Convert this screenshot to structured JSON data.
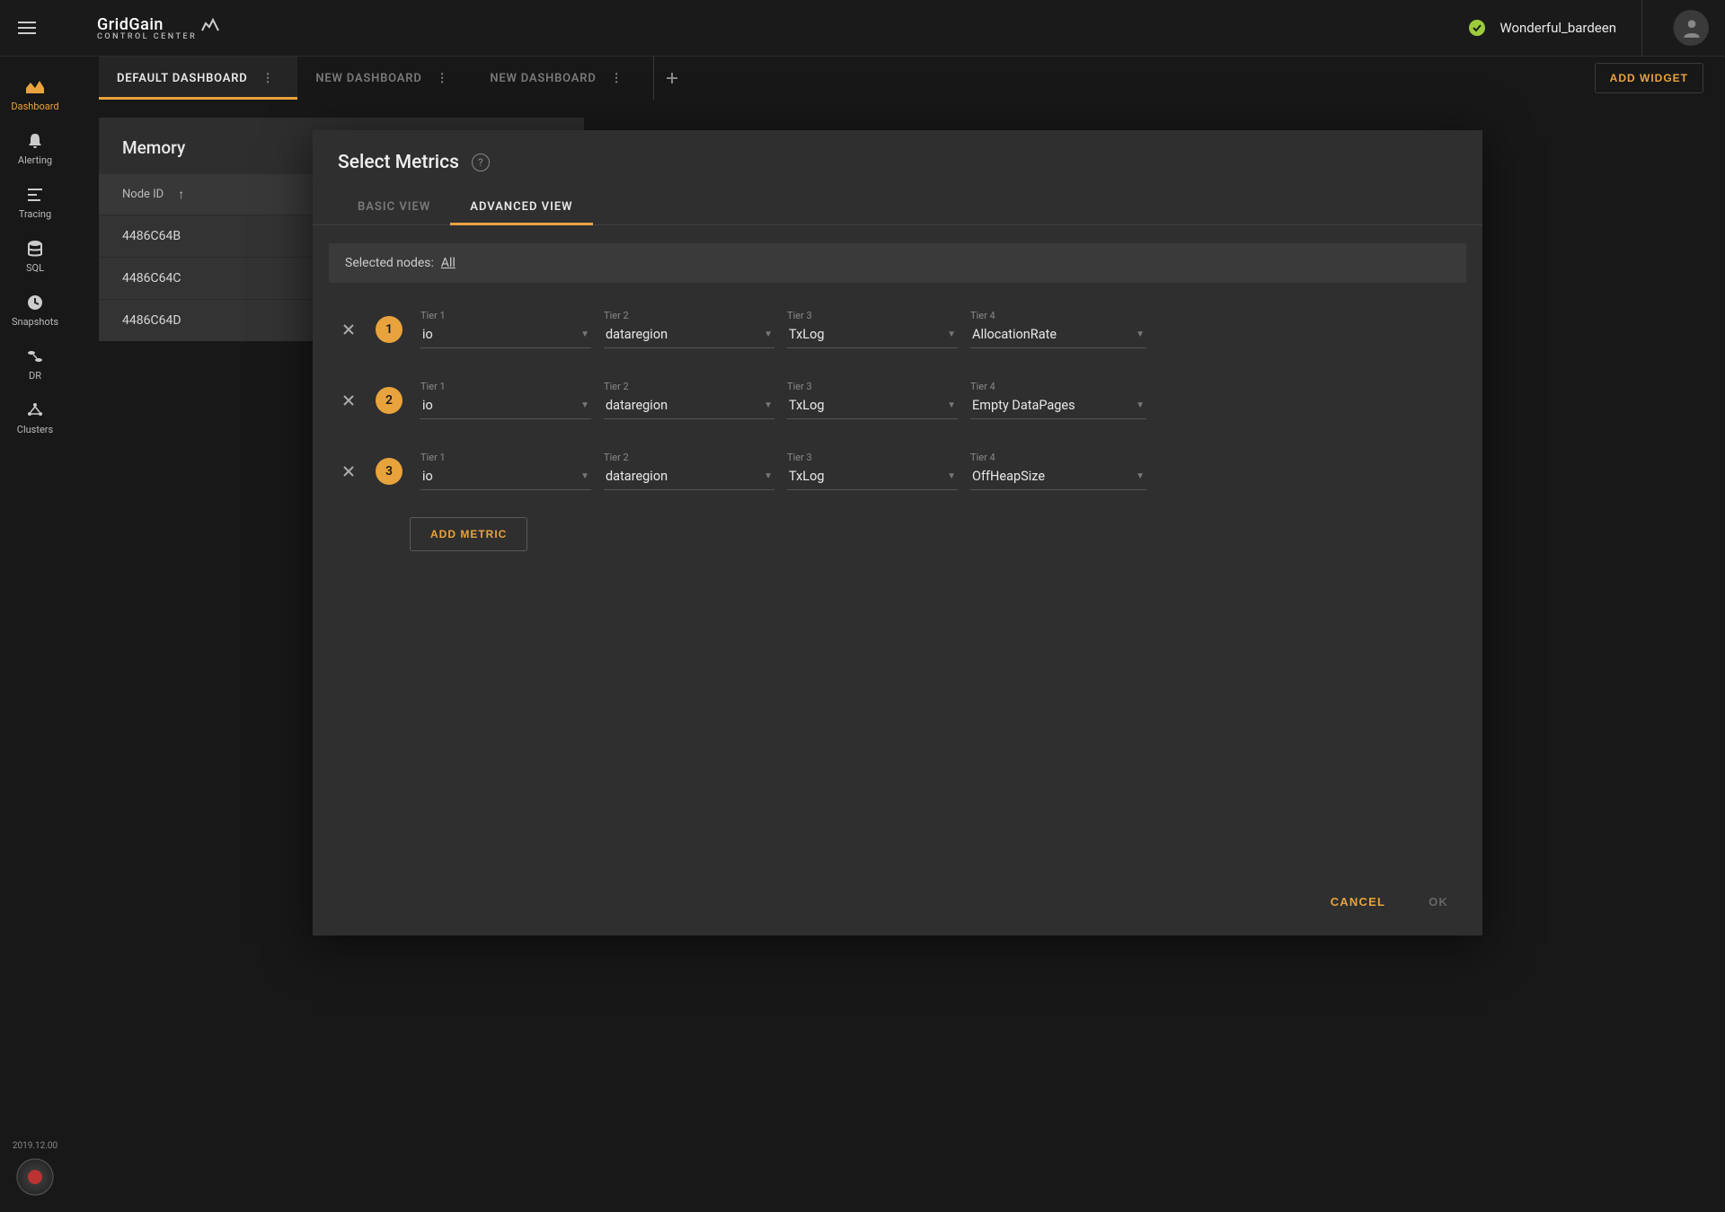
{
  "header": {
    "logo_main": "GridGain",
    "logo_sub": "CONTROL CENTER",
    "username": "Wonderful_bardeen"
  },
  "sidebar": {
    "items": [
      {
        "label": "Dashboard",
        "icon": "chart-area-icon",
        "active": true
      },
      {
        "label": "Alerting",
        "icon": "bell-icon",
        "active": false
      },
      {
        "label": "Tracing",
        "icon": "bars-icon",
        "active": false
      },
      {
        "label": "SQL",
        "icon": "database-icon",
        "active": false
      },
      {
        "label": "Snapshots",
        "icon": "clock-icon",
        "active": false
      },
      {
        "label": "DR",
        "icon": "replication-icon",
        "active": false
      },
      {
        "label": "Clusters",
        "icon": "network-icon",
        "active": false
      }
    ],
    "version": "2019.12.00"
  },
  "tabs": [
    {
      "label": "DEFAULT DASHBOARD",
      "active": true
    },
    {
      "label": "NEW DASHBOARD",
      "active": false
    },
    {
      "label": "NEW DASHBOARD",
      "active": false
    }
  ],
  "add_widget_label": "ADD WIDGET",
  "widget": {
    "title": "Memory",
    "header_col": "Node ID",
    "rows": [
      "4486C64B",
      "4486C64C",
      "4486C64D"
    ]
  },
  "modal": {
    "title": "Select Metrics",
    "tabs": {
      "basic": "BASIC VIEW",
      "advanced": "ADVANCED VIEW"
    },
    "selected_nodes_label": "Selected nodes:",
    "selected_nodes_value": "All",
    "tier_labels": {
      "t1": "Tier 1",
      "t2": "Tier 2",
      "t3": "Tier 3",
      "t4": "Tier 4"
    },
    "metrics": [
      {
        "num": "1",
        "t1": "io",
        "t2": "dataregion",
        "t3": "TxLog",
        "t4": "AllocationRate"
      },
      {
        "num": "2",
        "t1": "io",
        "t2": "dataregion",
        "t3": "TxLog",
        "t4": "Empty DataPages"
      },
      {
        "num": "3",
        "t1": "io",
        "t2": "dataregion",
        "t3": "TxLog",
        "t4": "OffHeapSize"
      }
    ],
    "add_metric_label": "ADD METRIC",
    "cancel_label": "CANCEL",
    "ok_label": "OK"
  }
}
